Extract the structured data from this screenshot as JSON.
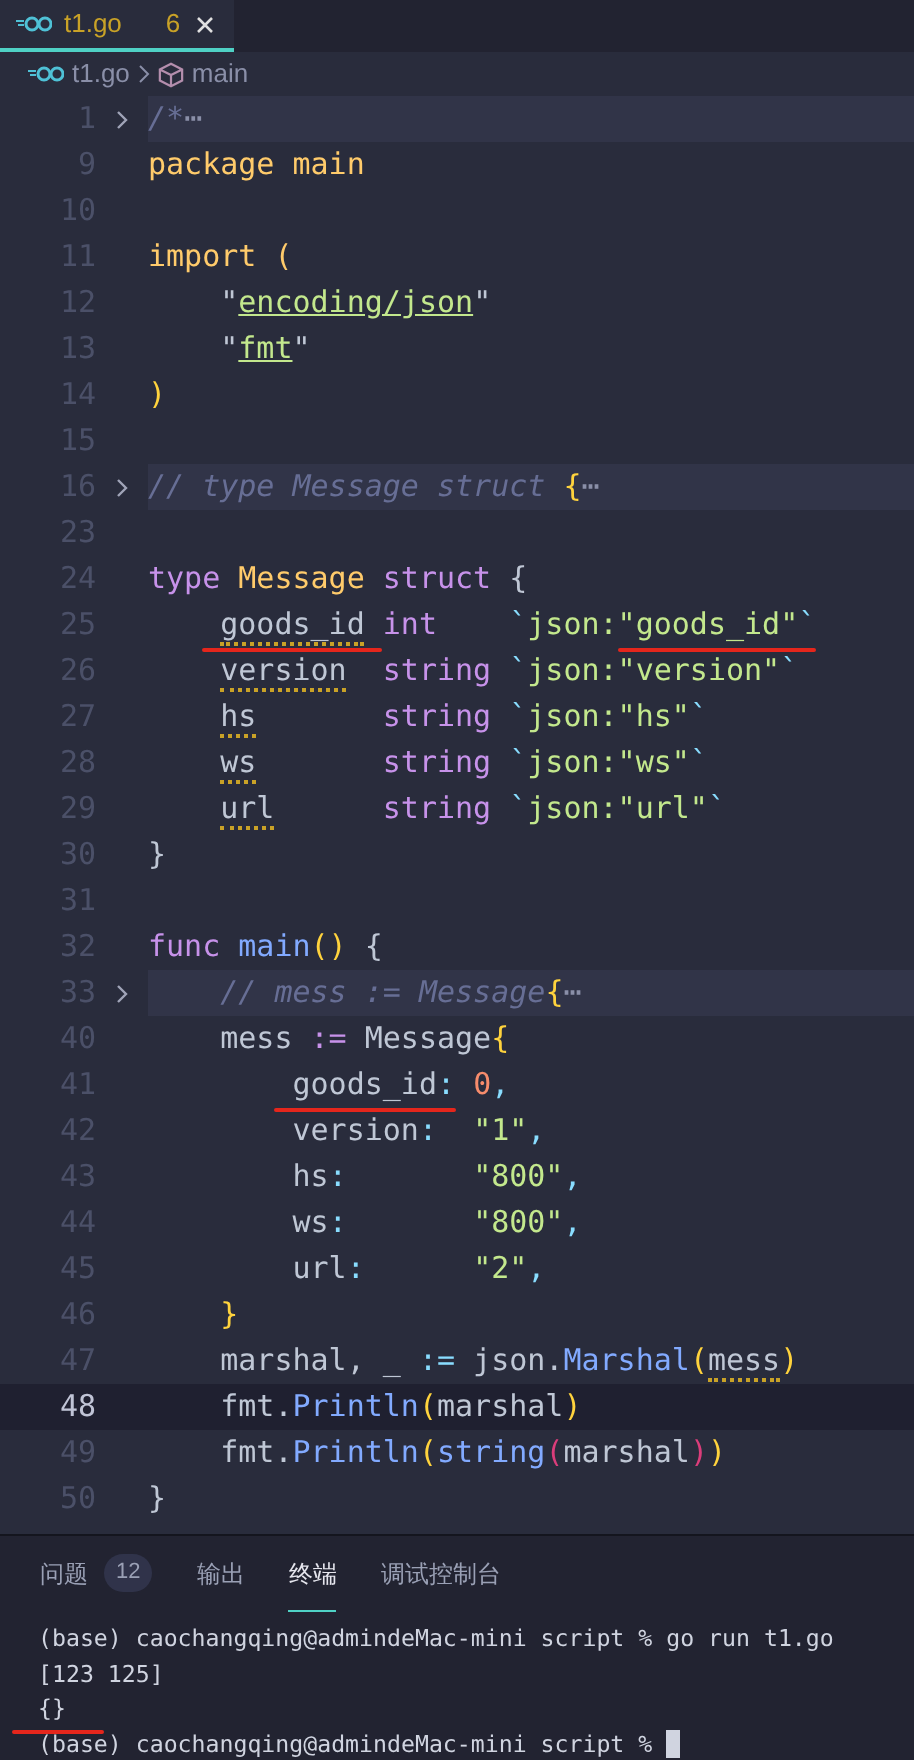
{
  "tab": {
    "title": "t1.go",
    "problem_count": "6",
    "selected": true,
    "has_errors": true
  },
  "breadcrumb": [
    {
      "label": "t1.go",
      "kind": "file"
    },
    {
      "label": "main",
      "kind": "symbol"
    }
  ],
  "editor": {
    "lines": [
      {
        "number": "1",
        "folded": true,
        "current": false,
        "tokens": [
          {
            "t": "/*",
            "kind": "cmt"
          },
          {
            "t": "⋯",
            "kind": "fold"
          }
        ]
      },
      {
        "number": "9",
        "folded": false,
        "current": false,
        "tokens": [
          {
            "t": "package main",
            "kind": "pkg"
          }
        ]
      },
      {
        "number": "10",
        "folded": false,
        "current": false
      },
      {
        "number": "11",
        "folded": false,
        "current": false,
        "tokens": [
          {
            "t": "import (",
            "kind": "pkg"
          }
        ]
      },
      {
        "number": "12",
        "folded": false,
        "current": false,
        "tokens": [
          {
            "t": "    \"",
            "kind": "plain"
          },
          {
            "t": "encoding/json",
            "kind": "path"
          },
          {
            "t": "\"",
            "kind": "plain"
          }
        ]
      },
      {
        "number": "13",
        "folded": false,
        "current": false,
        "tokens": [
          {
            "t": "    \"",
            "kind": "plain"
          },
          {
            "t": "fmt",
            "kind": "path"
          },
          {
            "t": "\"",
            "kind": "plain"
          }
        ]
      },
      {
        "number": "14",
        "folded": false,
        "current": false,
        "tokens": [
          {
            "t": ")",
            "kind": "bracket"
          }
        ]
      },
      {
        "number": "15",
        "folded": false,
        "current": false
      },
      {
        "number": "16",
        "folded": true,
        "current": false,
        "tokens": [
          {
            "t": "// type Message struct ",
            "kind": "cmt"
          },
          {
            "t": "{",
            "kind": "bracket"
          },
          {
            "t": "⋯",
            "kind": "fold"
          }
        ]
      },
      {
        "number": "23",
        "folded": false,
        "current": false
      },
      {
        "number": "24",
        "folded": false,
        "current": false,
        "tokens": [
          {
            "t": "type ",
            "kind": "kw"
          },
          {
            "t": "Message ",
            "kind": "pkg"
          },
          {
            "t": "struct ",
            "kind": "kw"
          },
          {
            "t": "{",
            "kind": "plain"
          }
        ]
      },
      {
        "number": "25",
        "folded": false,
        "current": false,
        "tokens": [
          {
            "t": "    goods_id ",
            "kind": "plain",
            "warn": true,
            "marked": true
          },
          {
            "t": "int    ",
            "kind": "kw"
          },
          {
            "t": "`",
            "kind": "op"
          },
          {
            "t": "json:\"",
            "kind": "str"
          },
          {
            "t": "goods_id\"",
            "kind": "str",
            "marked": true
          },
          {
            "t": "`",
            "kind": "op"
          }
        ]
      },
      {
        "number": "26",
        "folded": false,
        "current": false,
        "tokens": [
          {
            "t": "    version  ",
            "kind": "plain",
            "warn": true
          },
          {
            "t": "string ",
            "kind": "kw"
          },
          {
            "t": "`",
            "kind": "op"
          },
          {
            "t": "json:\"version\"",
            "kind": "str"
          },
          {
            "t": "`",
            "kind": "op"
          }
        ]
      },
      {
        "number": "27",
        "folded": false,
        "current": false,
        "tokens": [
          {
            "t": "    hs       ",
            "kind": "plain",
            "warn": true
          },
          {
            "t": "string ",
            "kind": "kw"
          },
          {
            "t": "`",
            "kind": "op"
          },
          {
            "t": "json:\"hs\"",
            "kind": "str"
          },
          {
            "t": "`",
            "kind": "op"
          }
        ]
      },
      {
        "number": "28",
        "folded": false,
        "current": false,
        "tokens": [
          {
            "t": "    ws       ",
            "kind": "plain",
            "warn": true
          },
          {
            "t": "string ",
            "kind": "kw"
          },
          {
            "t": "`",
            "kind": "op"
          },
          {
            "t": "json:\"ws\"",
            "kind": "str"
          },
          {
            "t": "`",
            "kind": "op"
          }
        ]
      },
      {
        "number": "29",
        "folded": false,
        "current": false,
        "tokens": [
          {
            "t": "    url      ",
            "kind": "plain",
            "warn": true
          },
          {
            "t": "string ",
            "kind": "kw"
          },
          {
            "t": "`",
            "kind": "op"
          },
          {
            "t": "json:\"url\"",
            "kind": "str"
          },
          {
            "t": "`",
            "kind": "op"
          }
        ]
      },
      {
        "number": "30",
        "folded": false,
        "current": false,
        "tokens": [
          {
            "t": "}",
            "kind": "plain"
          }
        ]
      },
      {
        "number": "31",
        "folded": false,
        "current": false
      },
      {
        "number": "32",
        "folded": false,
        "current": false,
        "tokens": [
          {
            "t": "func ",
            "kind": "kw"
          },
          {
            "t": "main",
            "kind": "fn"
          },
          {
            "t": "()",
            "kind": "bracket"
          },
          {
            "t": " {",
            "kind": "plain"
          }
        ]
      },
      {
        "number": "33",
        "folded": true,
        "current": false,
        "tokens": [
          {
            "t": "    // mess := Message",
            "kind": "cmt"
          },
          {
            "t": "{",
            "kind": "bracket"
          },
          {
            "t": "⋯",
            "kind": "fold"
          }
        ]
      },
      {
        "number": "40",
        "folded": false,
        "current": false,
        "tokens": [
          {
            "t": "    mess ",
            "kind": "plain"
          },
          {
            "t": ":=",
            "kind": "kw"
          },
          {
            "t": " Message",
            "kind": "plain"
          },
          {
            "t": "{",
            "kind": "bracket"
          }
        ]
      },
      {
        "number": "41",
        "folded": false,
        "current": false,
        "tokens": [
          {
            "t": "        goods_id",
            "kind": "plain",
            "marked": true
          },
          {
            "t": ": ",
            "kind": "op"
          },
          {
            "t": "0",
            "kind": "num"
          },
          {
            "t": ",",
            "kind": "op"
          }
        ]
      },
      {
        "number": "42",
        "folded": false,
        "current": false,
        "tokens": [
          {
            "t": "        version",
            "kind": "plain"
          },
          {
            "t": ":  ",
            "kind": "op"
          },
          {
            "t": "\"1\"",
            "kind": "str"
          },
          {
            "t": ",",
            "kind": "op"
          }
        ]
      },
      {
        "number": "43",
        "folded": false,
        "current": false,
        "tokens": [
          {
            "t": "        hs",
            "kind": "plain"
          },
          {
            "t": ":       ",
            "kind": "op"
          },
          {
            "t": "\"800\"",
            "kind": "str"
          },
          {
            "t": ",",
            "kind": "op"
          }
        ]
      },
      {
        "number": "44",
        "folded": false,
        "current": false,
        "tokens": [
          {
            "t": "        ws",
            "kind": "plain"
          },
          {
            "t": ":       ",
            "kind": "op"
          },
          {
            "t": "\"800\"",
            "kind": "str"
          },
          {
            "t": ",",
            "kind": "op"
          }
        ]
      },
      {
        "number": "45",
        "folded": false,
        "current": false,
        "tokens": [
          {
            "t": "        url",
            "kind": "plain"
          },
          {
            "t": ":      ",
            "kind": "op"
          },
          {
            "t": "\"2\"",
            "kind": "str"
          },
          {
            "t": ",",
            "kind": "op"
          }
        ]
      },
      {
        "number": "46",
        "folded": false,
        "current": false,
        "tokens": [
          {
            "t": "    }",
            "kind": "bracket"
          }
        ]
      },
      {
        "number": "47",
        "folded": false,
        "current": false,
        "tokens": [
          {
            "t": "    marshal, _ ",
            "kind": "plain"
          },
          {
            "t": ":=",
            "kind": "op"
          },
          {
            "t": " json.",
            "kind": "plain"
          },
          {
            "t": "Marshal",
            "kind": "fn"
          },
          {
            "t": "(",
            "kind": "bracket"
          },
          {
            "t": "mess",
            "kind": "plain",
            "warn": true
          },
          {
            "t": ")",
            "kind": "bracket"
          }
        ]
      },
      {
        "number": "48",
        "folded": false,
        "current": true,
        "tokens": [
          {
            "t": "    fmt.",
            "kind": "plain"
          },
          {
            "t": "Println",
            "kind": "fn"
          },
          {
            "t": "(",
            "kind": "bracket"
          },
          {
            "t": "marshal",
            "kind": "plain"
          },
          {
            "t": ")",
            "kind": "bracket"
          }
        ]
      },
      {
        "number": "49",
        "folded": false,
        "current": false,
        "tokens": [
          {
            "t": "    fmt.",
            "kind": "plain"
          },
          {
            "t": "Println",
            "kind": "fn"
          },
          {
            "t": "(",
            "kind": "bracket"
          },
          {
            "t": "string",
            "kind": "fn"
          },
          {
            "t": "(",
            "kind": "bracket2"
          },
          {
            "t": "marshal",
            "kind": "plain"
          },
          {
            "t": ")",
            "kind": "bracket2"
          },
          {
            "t": ")",
            "kind": "bracket"
          }
        ]
      },
      {
        "number": "50",
        "folded": false,
        "current": false,
        "tokens": [
          {
            "t": "}",
            "kind": "plain"
          }
        ]
      }
    ]
  },
  "panel": {
    "tabs": [
      {
        "label": "问题",
        "badge": "12",
        "selected": false
      },
      {
        "label": "输出",
        "selected": false
      },
      {
        "label": "终端",
        "selected": true
      },
      {
        "label": "调试控制台",
        "selected": false
      }
    ],
    "terminal": [
      {
        "text": "(base) caochangqing@admindeMac-mini script % go run t1.go",
        "marked": false
      },
      {
        "text": "[123 125]",
        "marked": false
      },
      {
        "text": "{}",
        "marked": true
      },
      {
        "text": "(base) caochangqing@admindeMac-mini script %",
        "marked": false
      }
    ]
  }
}
